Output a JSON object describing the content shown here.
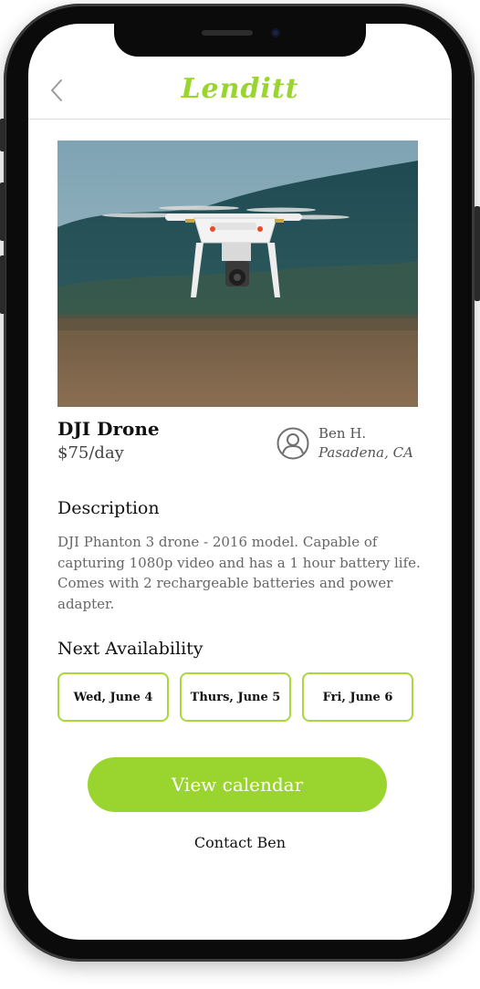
{
  "app": {
    "brand": "Lenditt",
    "accent_color": "#9ad52f",
    "chip_border_color": "#a8d83c"
  },
  "header": {
    "back_icon": "chevron-left-icon"
  },
  "product": {
    "name": "DJI Drone",
    "price": "$75/day",
    "image_alt": "DJI Phantom drone flying over a field"
  },
  "owner": {
    "icon": "user-circle-icon",
    "name": "Ben H.",
    "location": "Pasadena, CA"
  },
  "description": {
    "title": "Description",
    "text": "DJI Phanton 3 drone - 2016 model. Capable of capturing 1080p video and has a 1 hour battery life. Comes with 2 rechargeable batteries and power adapter."
  },
  "availability": {
    "title": "Next Availability",
    "dates": [
      "Wed, June 4",
      "Thurs, June 5",
      "Fri, June 6"
    ]
  },
  "actions": {
    "view_calendar": "View calendar",
    "contact": "Contact Ben"
  }
}
